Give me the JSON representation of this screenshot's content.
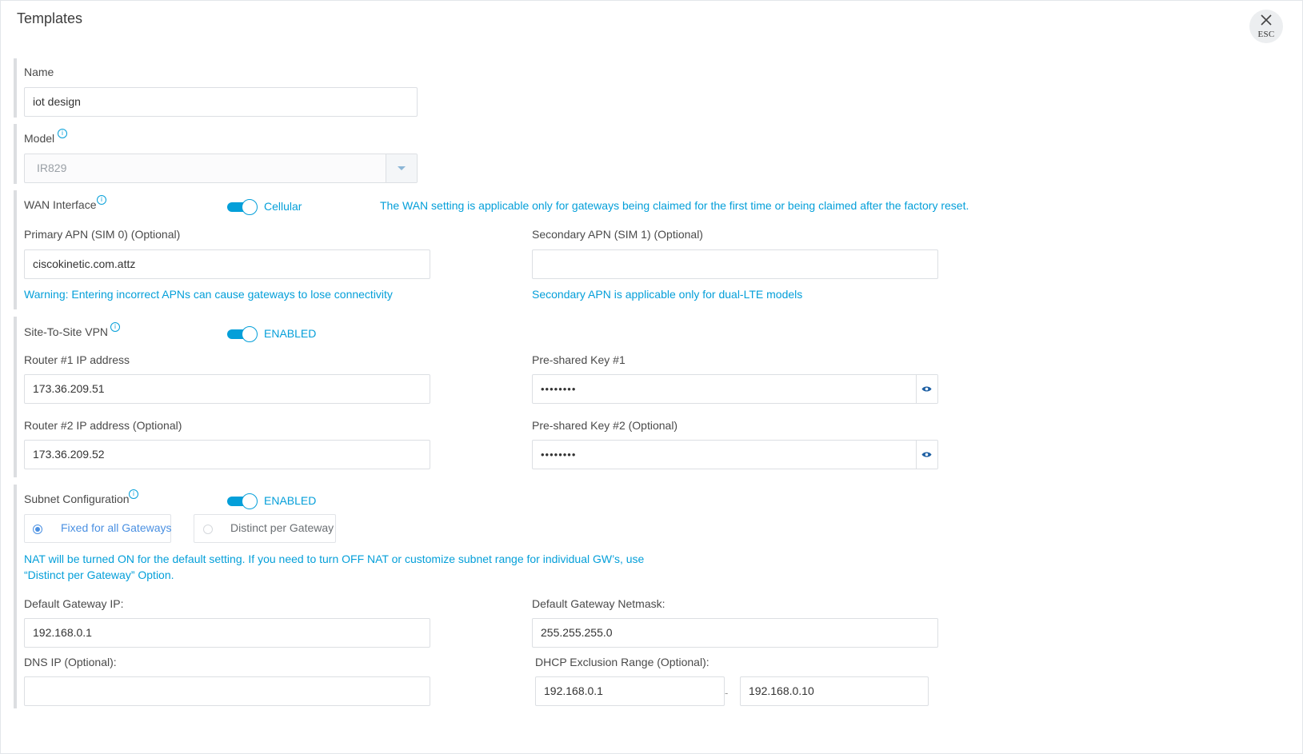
{
  "dialog": {
    "title": "Templates",
    "close_label": "ESC"
  },
  "name": {
    "label": "Name",
    "value": "iot design"
  },
  "model": {
    "label": "Model",
    "value": "IR829"
  },
  "wan": {
    "label": "WAN Interface",
    "toggle_label": "Cellular",
    "toggle_on": true,
    "note": "The WAN setting is applicable only for gateways being claimed for the first time or being claimed after the factory reset.",
    "primary_apn_label": "Primary APN (SIM 0) (Optional)",
    "primary_apn_value": "ciscokinetic.com.attz",
    "secondary_apn_label": "Secondary APN (SIM 1) (Optional)",
    "secondary_apn_value": "",
    "primary_warning": "Warning: Entering incorrect APNs can cause gateways to lose connectivity",
    "secondary_note": "Secondary APN is applicable only for dual-LTE models"
  },
  "vpn": {
    "label": "Site-To-Site VPN",
    "toggle_label": "ENABLED",
    "toggle_on": true,
    "router1_label": "Router #1 IP address",
    "router1_value": "173.36.209.51",
    "psk1_label": "Pre-shared Key #1",
    "psk1_value": "••••••••",
    "router2_label": "Router #2 IP address (Optional)",
    "router2_value": "173.36.209.52",
    "psk2_label": "Pre-shared Key #2 (Optional)",
    "psk2_value": "••••••••"
  },
  "subnet": {
    "label": "Subnet Configuration",
    "toggle_label": "ENABLED",
    "toggle_on": true,
    "option_fixed": "Fixed for all Gateways",
    "option_distinct": "Distinct per Gateway",
    "selected": "Fixed for all Gateways",
    "note": "NAT will be turned ON for the default setting. If you need to turn OFF NAT or customize subnet range for individual GW’s, use “Distinct per Gateway” Option.",
    "gateway_ip_label": "Default Gateway IP:",
    "gateway_ip_value": "192.168.0.1",
    "netmask_label": "Default Gateway Netmask:",
    "netmask_value": "255.255.255.0",
    "dns_label": "DNS IP (Optional):",
    "dns_value": "",
    "dhcp_label": "DHCP Exclusion Range (Optional):",
    "dhcp_start": "192.168.0.1",
    "dhcp_separator": "-",
    "dhcp_end": "192.168.0.10"
  },
  "colors": {
    "accent": "#049fd9",
    "radio": "#4a90e2",
    "border": "#dcdfe3",
    "section_bar": "#dcdee1"
  }
}
